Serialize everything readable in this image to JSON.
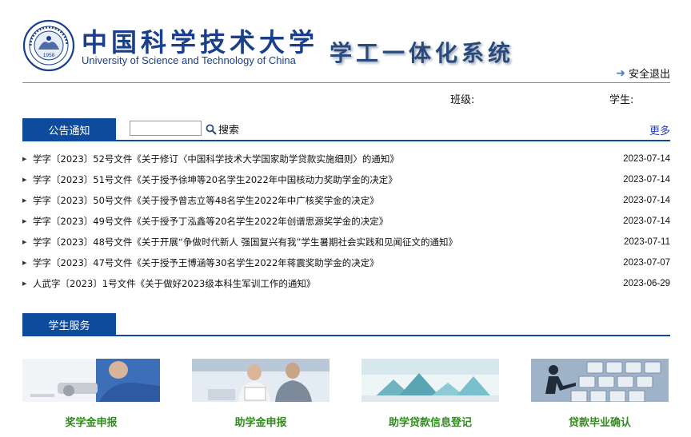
{
  "header": {
    "school_cn": "中国科学技术大学",
    "school_en": "University of Science and Technology of China",
    "seal_year": "1958",
    "system_title": "学工一体化系统",
    "logout_label": "安全退出"
  },
  "user_info": {
    "class_label": "班级:",
    "student_label": "学生:"
  },
  "notices": {
    "section_title": "公告通知",
    "search_value": "",
    "search_button": "搜索",
    "more_label": "更多",
    "items": [
      {
        "title": "学字〔2023〕52号文件《关于修订〈中国科学技术大学国家助学贷款实施细则〉的通知》",
        "date": "2023-07-14"
      },
      {
        "title": "学字〔2023〕51号文件《关于授予徐坤等20名学生2022年中国核动力奖助学金的决定》",
        "date": "2023-07-14"
      },
      {
        "title": "学字〔2023〕50号文件《关于授予曾志立等48名学生2022年中广核奖学金的决定》",
        "date": "2023-07-14"
      },
      {
        "title": "学字〔2023〕49号文件《关于授予丁泓鑫等20名学生2022年创谱思源奖学金的决定》",
        "date": "2023-07-14"
      },
      {
        "title": "学字〔2023〕48号文件《关于开展“争做时代新人 强国复兴有我”学生暑期社会实践和见闻征文的通知》",
        "date": "2023-07-11"
      },
      {
        "title": "学字〔2023〕47号文件《关于授予王博涵等30名学生2022年蒋震奖助学金的决定》",
        "date": "2023-07-07"
      },
      {
        "title": "人武字〔2023〕1号文件《关于做好2023级本科生军训工作的通知》",
        "date": "2023-06-29"
      }
    ]
  },
  "services": {
    "section_title": "学生服务",
    "items": [
      {
        "label": "奖学金申报"
      },
      {
        "label": "助学金申报"
      },
      {
        "label": "助学贷款信息登记"
      },
      {
        "label": "贷款毕业确认"
      }
    ]
  },
  "colors": {
    "brand_blue": "#0e4b9c",
    "service_green": "#2f8c1b",
    "more_link": "#2c3fb0"
  }
}
